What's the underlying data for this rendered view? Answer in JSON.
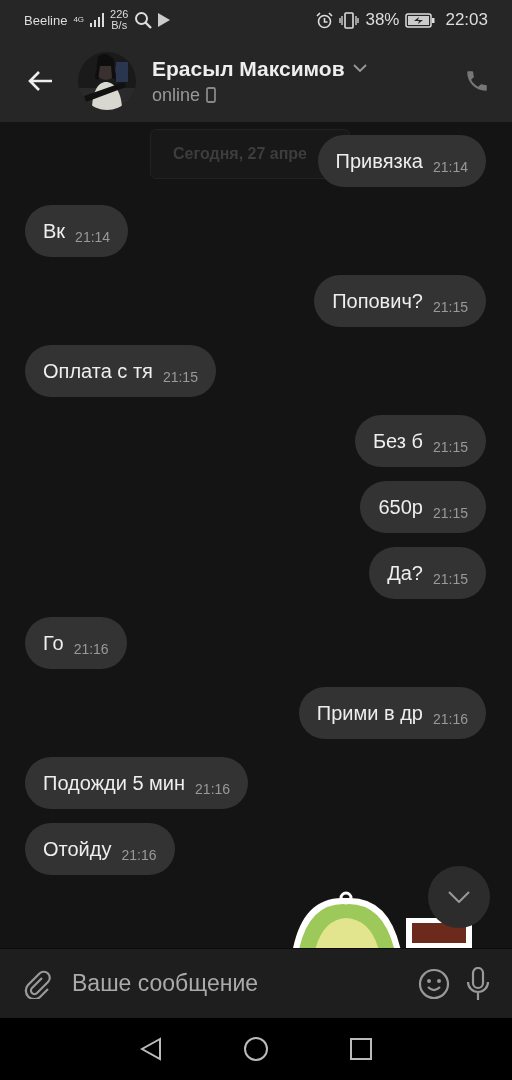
{
  "status_bar": {
    "carrier": "Beeline",
    "network": "4G",
    "speed_value": "226",
    "speed_unit": "B/s",
    "battery": "38%",
    "time": "22:03"
  },
  "header": {
    "name": "Ерасыл Максимов",
    "presence": "online"
  },
  "date_chip": "Сегодня, 27 апре",
  "messages": [
    {
      "text": "Привязка",
      "time": "21:14",
      "outgoing": true
    },
    {
      "text": "Вк",
      "time": "21:14",
      "outgoing": false
    },
    {
      "text": "Попович?",
      "time": "21:15",
      "outgoing": true
    },
    {
      "text": "Оплата с тя",
      "time": "21:15",
      "outgoing": false
    },
    {
      "text": "Без б",
      "time": "21:15",
      "outgoing": true
    },
    {
      "text": "650р",
      "time": "21:15",
      "outgoing": true
    },
    {
      "text": "Да?",
      "time": "21:15",
      "outgoing": true
    },
    {
      "text": "Го",
      "time": "21:16",
      "outgoing": false
    },
    {
      "text": "Прими в др",
      "time": "21:16",
      "outgoing": true
    },
    {
      "text": "Подожди 5 мин",
      "time": "21:16",
      "outgoing": false
    },
    {
      "text": "Отойду",
      "time": "21:16",
      "outgoing": false
    }
  ],
  "composer": {
    "placeholder": "Ваше сообщение"
  }
}
